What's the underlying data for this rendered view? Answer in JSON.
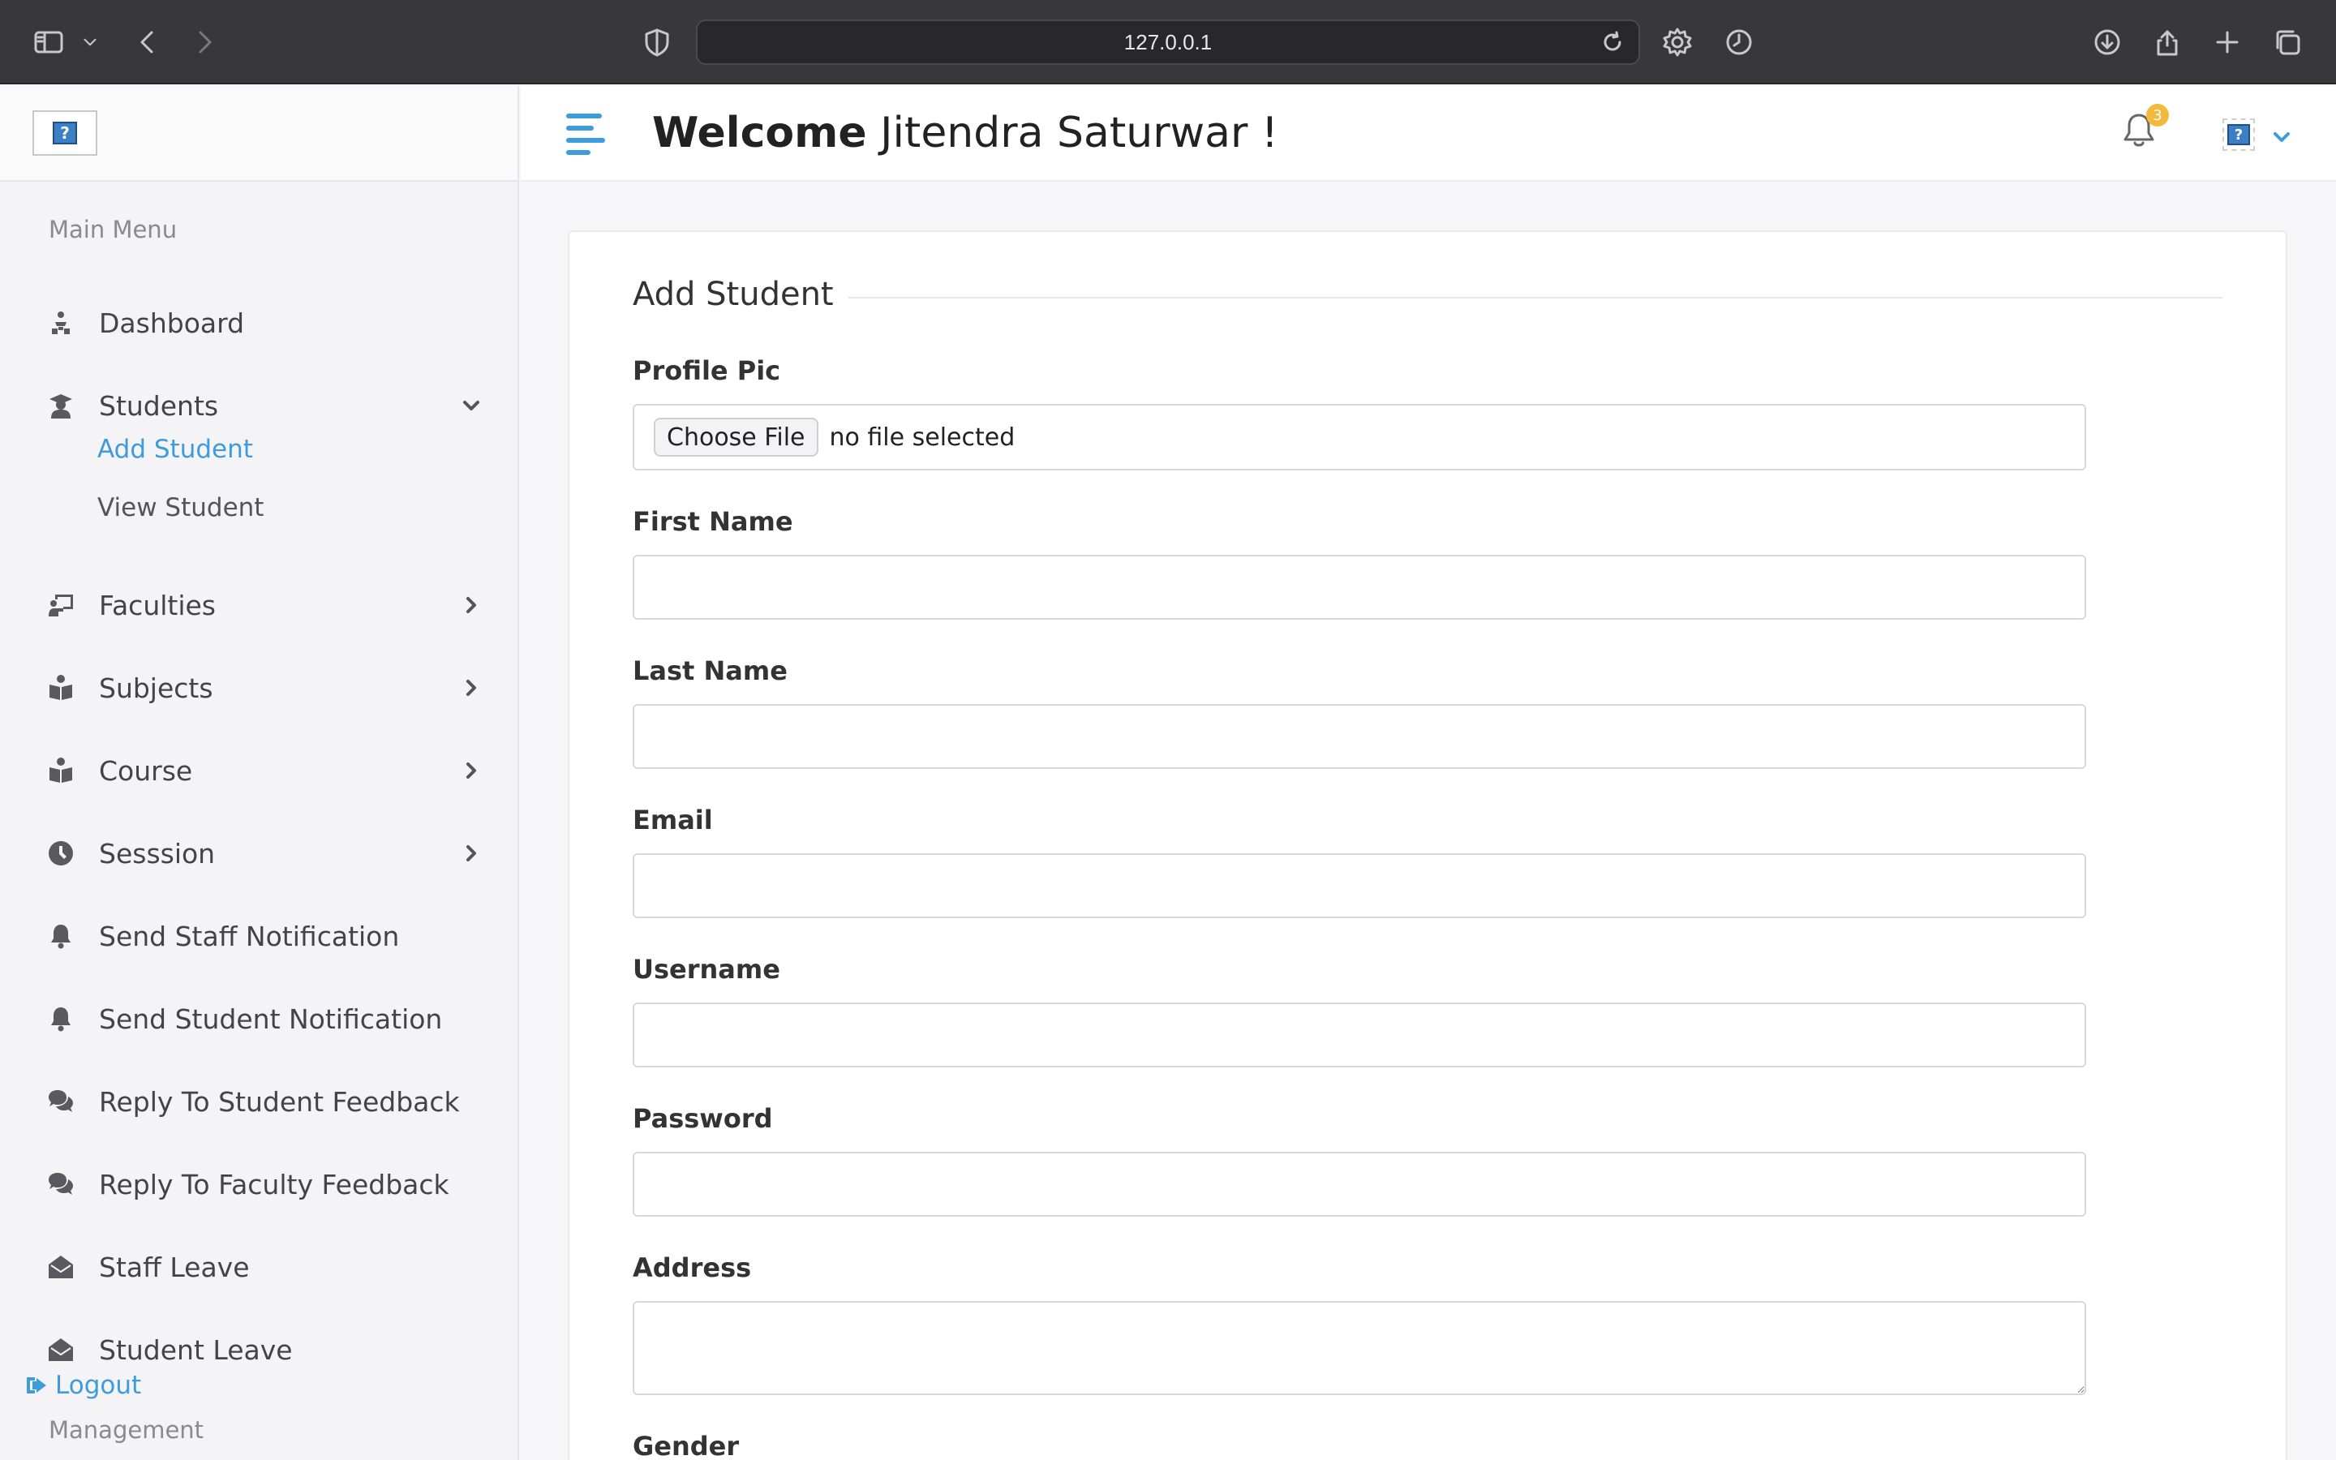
{
  "browser": {
    "url": "127.0.0.1",
    "icons": [
      "sidebar-icon",
      "chevron-down-icon",
      "back-icon",
      "forward-icon",
      "shield-icon",
      "reload-icon",
      "settings-icon",
      "history-icon",
      "download-icon",
      "share-icon",
      "new-tab-icon",
      "tabs-icon"
    ]
  },
  "header": {
    "welcome_prefix": "Welcome",
    "user_name": "Jitendra Saturwar  !",
    "notification_count": "3",
    "accent_color": "#3e9bdc"
  },
  "sidebar": {
    "main_menu_title": "Main Menu",
    "items": [
      {
        "label": "Dashboard",
        "icon": "dashboard-icon"
      },
      {
        "label": "Students",
        "icon": "graduate-icon",
        "expanded": true,
        "children": [
          {
            "label": "Add Student",
            "active": true
          },
          {
            "label": "View Student"
          }
        ]
      },
      {
        "label": "Faculties",
        "icon": "chalkboard-teacher-icon"
      },
      {
        "label": "Subjects",
        "icon": "book-reader-icon"
      },
      {
        "label": "Course",
        "icon": "book-reader-icon"
      },
      {
        "label": "Sesssion",
        "icon": "clock-icon"
      },
      {
        "label": "Send Staff Notification",
        "icon": "bell-icon"
      },
      {
        "label": "Send Student Notification",
        "icon": "bell-icon"
      },
      {
        "label": "Reply To Student Feedback",
        "icon": "comments-icon"
      },
      {
        "label": "Reply To Faculty Feedback",
        "icon": "comments-icon"
      },
      {
        "label": "Staff Leave",
        "icon": "envelope-open-icon"
      },
      {
        "label": "Student Leave",
        "icon": "envelope-open-icon"
      }
    ],
    "logout_label": "Logout",
    "management_title": "Management"
  },
  "form": {
    "title": "Add Student",
    "profile_pic": {
      "label": "Profile Pic",
      "button": "Choose File",
      "status": "no file selected"
    },
    "fields": [
      {
        "label": "First Name",
        "value": ""
      },
      {
        "label": "Last Name",
        "value": ""
      },
      {
        "label": "Email",
        "value": ""
      },
      {
        "label": "Username",
        "value": ""
      },
      {
        "label": "Password",
        "value": ""
      }
    ],
    "address": {
      "label": "Address",
      "value": ""
    },
    "gender": {
      "label": "Gender"
    }
  }
}
